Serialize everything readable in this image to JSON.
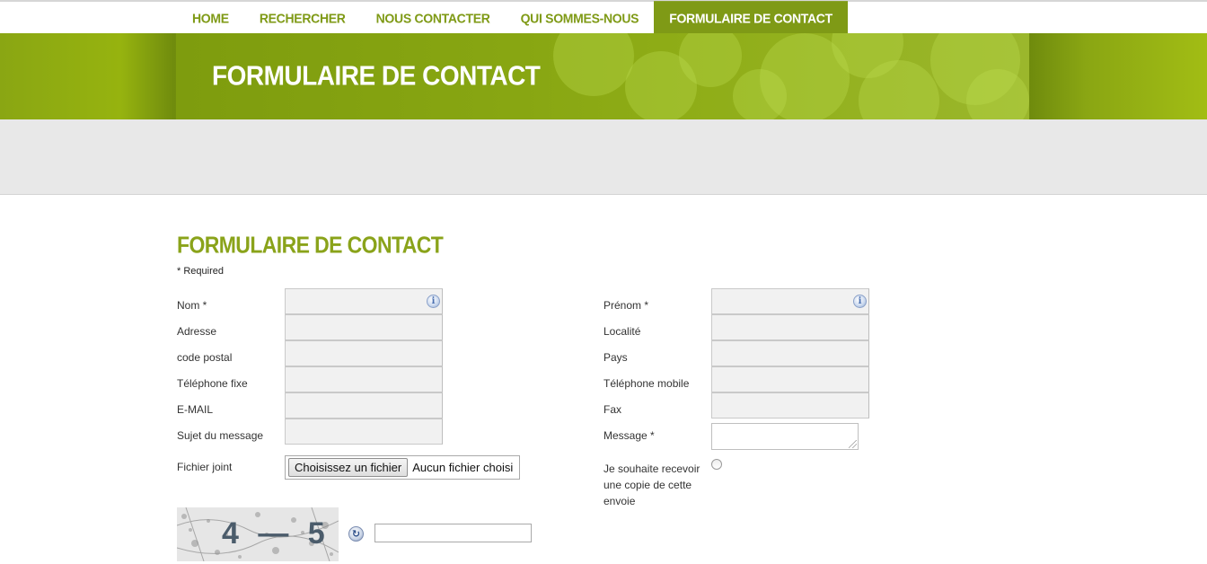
{
  "nav": {
    "items": [
      {
        "label": "HOME",
        "active": false
      },
      {
        "label": "RECHERCHER",
        "active": false
      },
      {
        "label": "NOUS CONTACTER",
        "active": false
      },
      {
        "label": "QUI SOMMES-NOUS",
        "active": false
      },
      {
        "label": "FORMULAIRE DE CONTACT",
        "active": true
      }
    ]
  },
  "banner": {
    "title": "FORMULAIRE DE CONTACT"
  },
  "form": {
    "title": "FORMULAIRE DE CONTACT",
    "required_note": "* Required",
    "left": {
      "nom": "Nom  *",
      "adresse": "Adresse",
      "code_postal": "code postal",
      "telephone_fixe": "Téléphone fixe",
      "email": "E-MAIL",
      "sujet": "Sujet du message",
      "fichier": "Fichier joint"
    },
    "right": {
      "prenom": "Prénom  *",
      "localite": "Localité",
      "pays": "Pays",
      "telephone_mobile": "Téléphone mobile",
      "fax": "Fax",
      "message": "Message  *",
      "copie_line1": "Je souhaite recevoir",
      "copie_line2": "une copie de cette",
      "copie_line3": "envoie"
    },
    "file_button": "Choisissez un fichier",
    "file_status": "Aucun fichier choisi",
    "captcha_text": "4 — 5"
  },
  "colors": {
    "accent": "#7f9a16",
    "banner": "#84a011",
    "band": "#e8e8e8"
  },
  "icons": {
    "info": "info-icon",
    "refresh": "refresh-icon"
  }
}
